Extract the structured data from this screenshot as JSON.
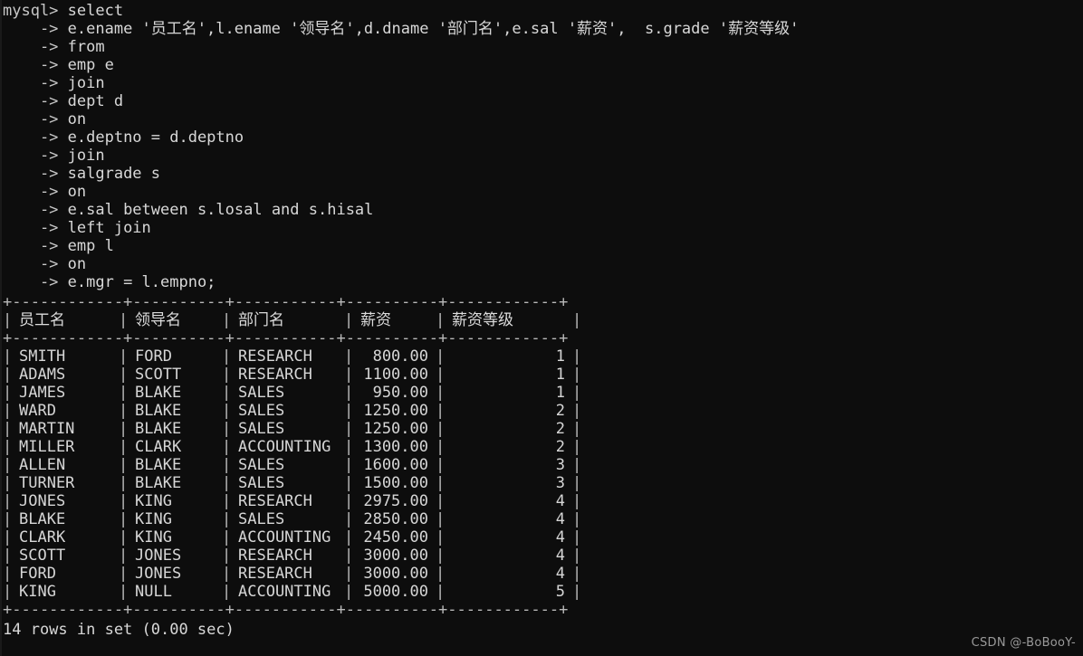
{
  "terminal": {
    "prompt": "mysql>",
    "continuation": "->",
    "first_command": "select",
    "sql_lines": [
      "e.ename '员工名',l.ename '领导名',d.dname '部门名',e.sal '薪资',  s.grade '薪资等级'",
      "from",
      "emp e",
      "join",
      "dept d",
      "on",
      "e.deptno = d.deptno",
      "join",
      "salgrade s",
      "on",
      "e.sal between s.losal and s.hisal",
      "left join",
      "emp l",
      "on",
      "e.mgr = l.empno;"
    ],
    "status_line": "14 rows in set (0.00 sec)",
    "watermark": "CSDN @-BoBooY-"
  },
  "result_table": {
    "top_rule": "+------------+----------+-----------+----------+------------+",
    "header_rule": "+------------+----------+-----------+----------+------------+",
    "bottom_rule": "+------------+----------+-----------+----------+------------+",
    "columns": [
      "员工名",
      "领导名",
      "部门名",
      "薪资",
      "薪资等级"
    ],
    "rows": [
      {
        "employee": "SMITH",
        "leader": "FORD",
        "department": "RESEARCH",
        "salary": "800.00",
        "grade": "1"
      },
      {
        "employee": "ADAMS",
        "leader": "SCOTT",
        "department": "RESEARCH",
        "salary": "1100.00",
        "grade": "1"
      },
      {
        "employee": "JAMES",
        "leader": "BLAKE",
        "department": "SALES",
        "salary": "950.00",
        "grade": "1"
      },
      {
        "employee": "WARD",
        "leader": "BLAKE",
        "department": "SALES",
        "salary": "1250.00",
        "grade": "2"
      },
      {
        "employee": "MARTIN",
        "leader": "BLAKE",
        "department": "SALES",
        "salary": "1250.00",
        "grade": "2"
      },
      {
        "employee": "MILLER",
        "leader": "CLARK",
        "department": "ACCOUNTING",
        "salary": "1300.00",
        "grade": "2"
      },
      {
        "employee": "ALLEN",
        "leader": "BLAKE",
        "department": "SALES",
        "salary": "1600.00",
        "grade": "3"
      },
      {
        "employee": "TURNER",
        "leader": "BLAKE",
        "department": "SALES",
        "salary": "1500.00",
        "grade": "3"
      },
      {
        "employee": "JONES",
        "leader": "KING",
        "department": "RESEARCH",
        "salary": "2975.00",
        "grade": "4"
      },
      {
        "employee": "BLAKE",
        "leader": "KING",
        "department": "SALES",
        "salary": "2850.00",
        "grade": "4"
      },
      {
        "employee": "CLARK",
        "leader": "KING",
        "department": "ACCOUNTING",
        "salary": "2450.00",
        "grade": "4"
      },
      {
        "employee": "SCOTT",
        "leader": "JONES",
        "department": "RESEARCH",
        "salary": "3000.00",
        "grade": "4"
      },
      {
        "employee": "FORD",
        "leader": "JONES",
        "department": "RESEARCH",
        "salary": "3000.00",
        "grade": "4"
      },
      {
        "employee": "KING",
        "leader": "NULL",
        "department": "ACCOUNTING",
        "salary": "5000.00",
        "grade": "5"
      }
    ]
  },
  "colors": {
    "background": "#0d0d0d",
    "text": "#d6d6d6",
    "border": "#b9b9b9",
    "watermark": "#9a9a9a"
  }
}
